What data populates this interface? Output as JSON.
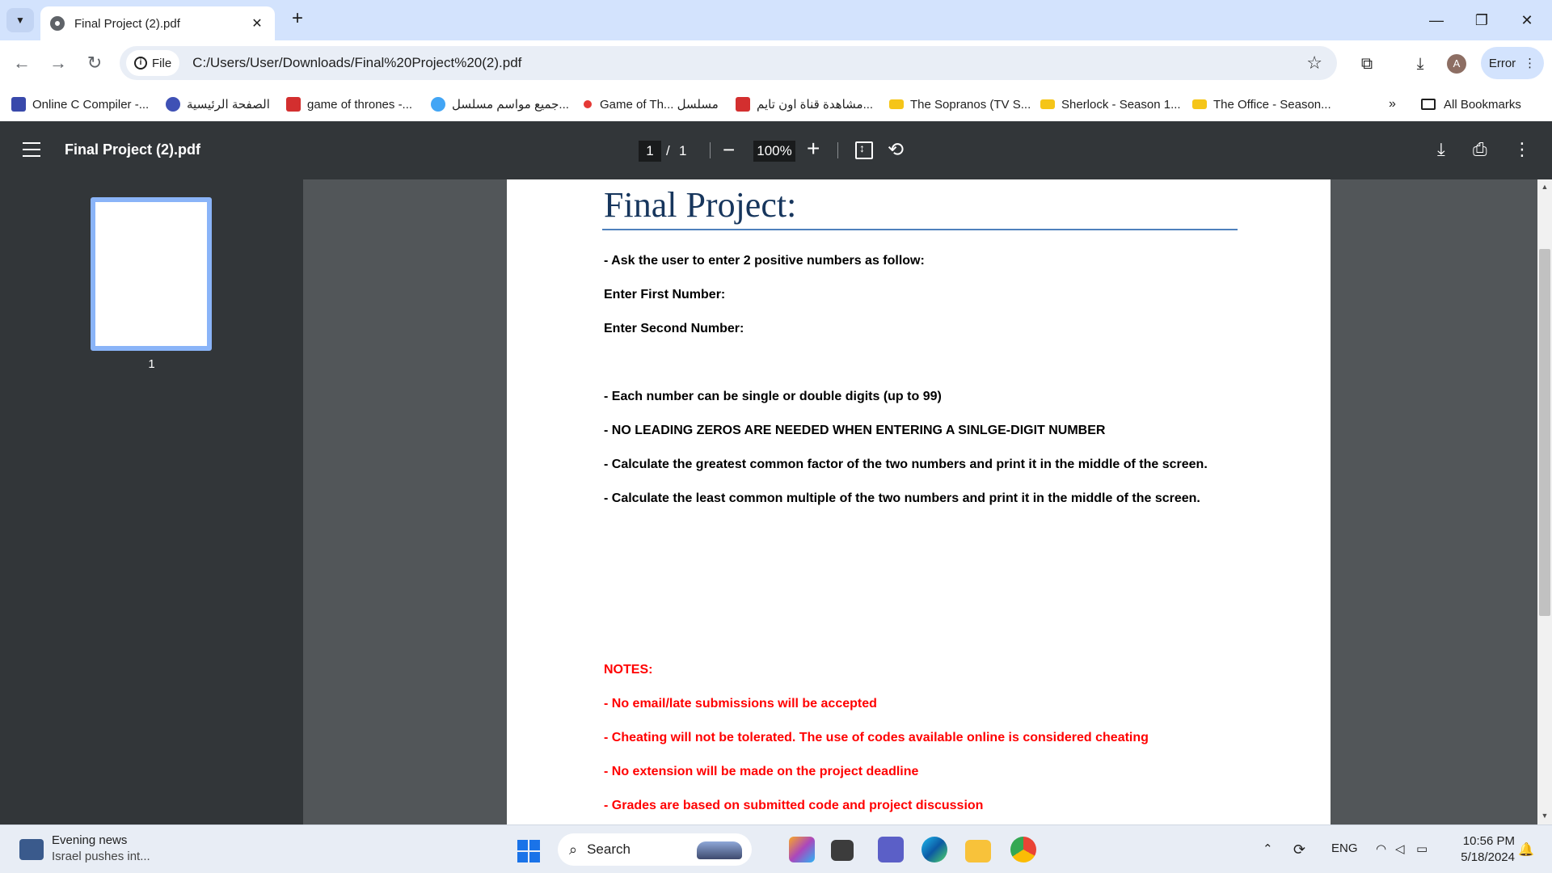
{
  "browser": {
    "tab_title": "Final Project (2).pdf",
    "url_scheme": "File",
    "url": "C:/Users/User/Downloads/Final%20Project%20(2).pdf",
    "profile_initial": "A",
    "error_label": "Error"
  },
  "bookmarks": {
    "items": [
      {
        "label": "Online C Compiler -...",
        "color": "#3949ab"
      },
      {
        "label": "الصفحة الرئيسية",
        "color": "#3f51b5"
      },
      {
        "label": "game of thrones -...",
        "color": "#d32f2f"
      },
      {
        "label": "جميع مواسم مسلسل...",
        "color": "#42a5f5"
      },
      {
        "label": "Game of Th... مسلسل",
        "color": "#e53935"
      },
      {
        "label": "مشاهدة قناة اون تايم...",
        "color": "#d32f2f"
      },
      {
        "label": "The Sopranos (TV S...",
        "color": "#f5c518"
      },
      {
        "label": "Sherlock - Season 1...",
        "color": "#f5c518"
      },
      {
        "label": "The Office - Season...",
        "color": "#f5c518"
      }
    ],
    "all_bookmarks": "All Bookmarks"
  },
  "pdf": {
    "title": "Final Project (2).pdf",
    "current_page": "1",
    "page_sep": "/",
    "total_pages": "1",
    "zoom": "100%",
    "thumb_label": "1"
  },
  "document": {
    "heading": "Final Project:",
    "lines": [
      "- Ask the user to enter 2 positive numbers as follow:",
      "Enter First Number:",
      "Enter Second Number:",
      "- Each number can be single or double digits (up to 99)",
      "- NO LEADING ZEROS ARE NEEDED WHEN ENTERING A SINLGE-DIGIT NUMBER",
      "- Calculate the greatest common factor of the two numbers and print it in the middle of  the screen.",
      "- Calculate the least common multiple of the two numbers and print it in the middle of  the screen."
    ],
    "notes_heading": "NOTES:",
    "notes": [
      "- No email/late submissions  will be accepted",
      "- Cheating will not be tolerated. The use of codes available online is considered cheating",
      "- No extension will be made on the project deadline",
      "- Grades are based on submitted code and project discussion"
    ]
  },
  "taskbar": {
    "news_title": "Evening news",
    "news_subtitle": "Israel pushes int...",
    "search_label": "Search",
    "language": "ENG",
    "time": "10:56 PM",
    "date": "5/18/2024"
  },
  "colors": {
    "heading": "#17365d",
    "notes": "#ff0000",
    "accent": "#8ab4f8"
  }
}
